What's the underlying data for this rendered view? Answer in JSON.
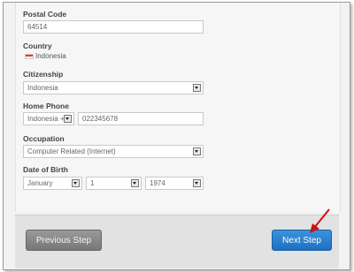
{
  "form": {
    "postal_code": {
      "label": "Postal Code",
      "value": "64514"
    },
    "country": {
      "label": "Country",
      "value": "Indonesia"
    },
    "citizenship": {
      "label": "Citizenship",
      "value": "Indonesia"
    },
    "home_phone": {
      "label": "Home Phone",
      "country_code": "Indonesia +",
      "number": "022345678"
    },
    "occupation": {
      "label": "Occupation",
      "value": "Computer Related (Internet)"
    },
    "date_of_birth": {
      "label": "Date of Birth",
      "month": "January",
      "day": "1",
      "year": "1974"
    }
  },
  "footer": {
    "previous_label": "Previous Step",
    "next_label": "Next Step"
  },
  "colors": {
    "next_button": "#1f6fc1",
    "previous_button": "#888888",
    "annotation_arrow": "#cc1111"
  },
  "icons": [
    "indonesia-flag-icon",
    "dropdown-arrow-icon",
    "red-pointer-arrow-icon"
  ]
}
